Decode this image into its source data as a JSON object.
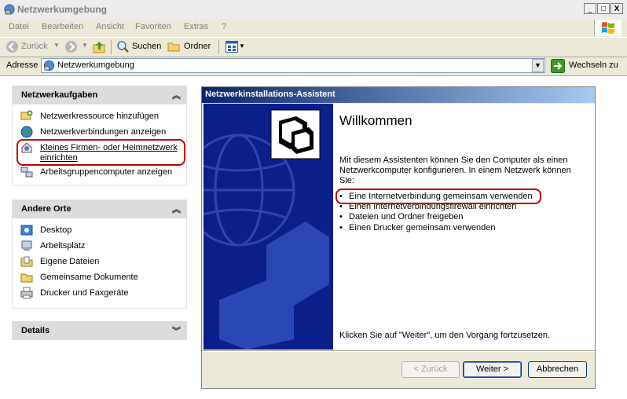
{
  "window": {
    "title": "Netzwerkumgebung",
    "min": "_",
    "max": "□",
    "close": "X"
  },
  "menu": [
    "Datei",
    "Bearbeiten",
    "Ansicht",
    "Favoriten",
    "Extras",
    "?"
  ],
  "toolbar": {
    "back": "Zurück",
    "search": "Suchen",
    "folders": "Ordner"
  },
  "address": {
    "label": "Adresse",
    "value": "Netzwerkumgebung",
    "go": "Wechseln zu"
  },
  "network_tasks": {
    "title": "Netzwerkaufgaben",
    "items": [
      {
        "label": "Netzwerkressource hinzufügen"
      },
      {
        "label": "Netzwerkverbindungen anzeigen"
      },
      {
        "label": "Kleines Firmen- oder Heimnetzwerk",
        "label2": "einrichten"
      },
      {
        "label": "Arbeitsgruppencomputer anzeigen"
      }
    ]
  },
  "other_places": {
    "title": "Andere Orte",
    "items": [
      {
        "label": "Desktop"
      },
      {
        "label": "Arbeitsplatz"
      },
      {
        "label": "Eigene Dateien"
      },
      {
        "label": "Gemeinsame Dokumente"
      },
      {
        "label": "Drucker und Faxgeräte"
      }
    ]
  },
  "details": {
    "title": "Details"
  },
  "wizard": {
    "title": "Netzwerkinstallations-Assistent",
    "heading": "Willkommen",
    "intro_lines": [
      "Mit diesem Assistenten können Sie den Computer als einen",
      "Netzwerkcomputer konfigurieren. In einem Netzwerk können",
      "Sie:"
    ],
    "bullets": [
      "Eine Internetverbindung gemeinsam verwenden",
      "Einen Internetverbindungsfirewall einrichten",
      "Dateien und Ordner freigeben",
      "Einen Drucker gemeinsam verwenden"
    ],
    "bullet_char": "•",
    "footer": "Klicken Sie auf \"Weiter\", um den Vorgang fortzusetzen.",
    "buttons": {
      "back": "< Zurück",
      "next": "Weiter >",
      "cancel": "Abbrechen"
    }
  },
  "colors": {
    "highlight": "#c00000",
    "wizard_side": "#0b1f8a",
    "title_gradient_start": "#0a246a"
  }
}
